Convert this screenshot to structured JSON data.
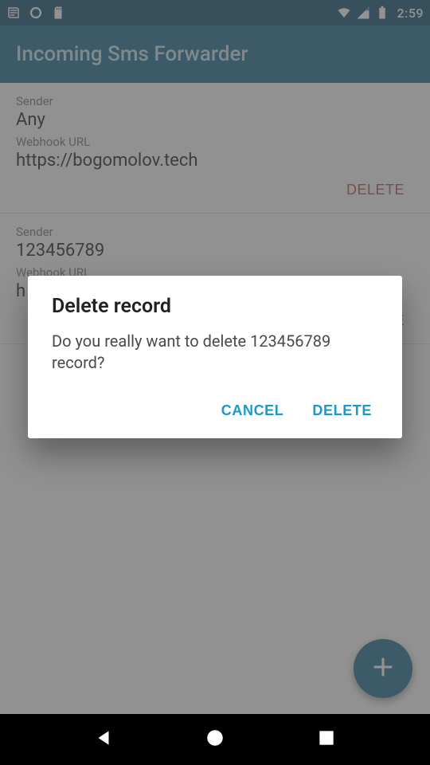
{
  "status": {
    "time": "2:59"
  },
  "appbar": {
    "title": "Incoming Sms Forwarder"
  },
  "labels": {
    "sender": "Sender",
    "webhook": "Webhook URL",
    "delete": "DELETE"
  },
  "records": [
    {
      "sender": "Any",
      "webhook": "https://bogomolov.tech"
    },
    {
      "sender": "123456789",
      "webhook": "h"
    }
  ],
  "dialog": {
    "title": "Delete record",
    "message": "Do you really want to delete 123456789 record?",
    "cancel": "CANCEL",
    "confirm": "DELETE"
  }
}
